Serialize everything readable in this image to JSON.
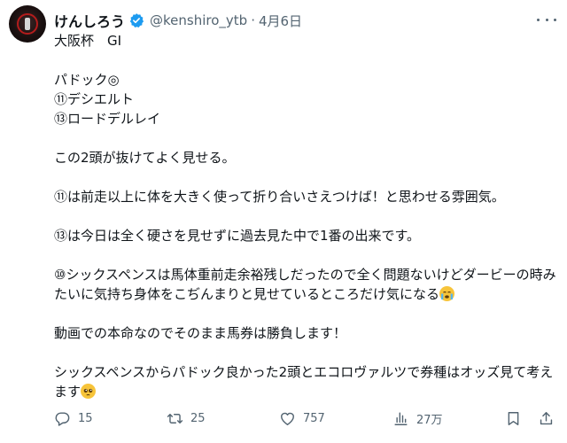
{
  "account": {
    "display_name": "けんしろう",
    "handle": "@kenshiro_ytb",
    "separator": "·",
    "date": "4月6日",
    "verified": true
  },
  "tweet": {
    "lines": [
      "大阪杯　GI",
      "",
      "パドック◎",
      "⑪デシエルト",
      "⑬ロードデルレイ",
      "",
      "この2頭が抜けてよく見せる。",
      "",
      "⑪は前走以上に体を大きく使って折り合いさえつけば！と思わせる雰囲気。",
      "",
      "⑬は今日は全く硬さを見せずに過去見た中で1番の出来です。",
      "",
      "⑩シックスペンスは馬体重前走余裕残しだったので全く問題ないけどダービーの時みたいに気持ち身体をこぢんまりと見せているところだけ気になる",
      "",
      "動画での本命なのでそのまま馬券は勝負します！",
      "",
      "シックスペンスからパドック良かった2頭とエコロヴァルツで券種はオッズ見て考えます"
    ],
    "emoji_after_line_12": "loudly-crying-face",
    "emoji_after_line_16": "pleading-face"
  },
  "metrics": {
    "replies": "15",
    "retweets": "25",
    "likes": "757",
    "views": "27万"
  },
  "colors": {
    "text": "#0f1419",
    "muted": "#536471",
    "verified": "#1d9bf0"
  }
}
